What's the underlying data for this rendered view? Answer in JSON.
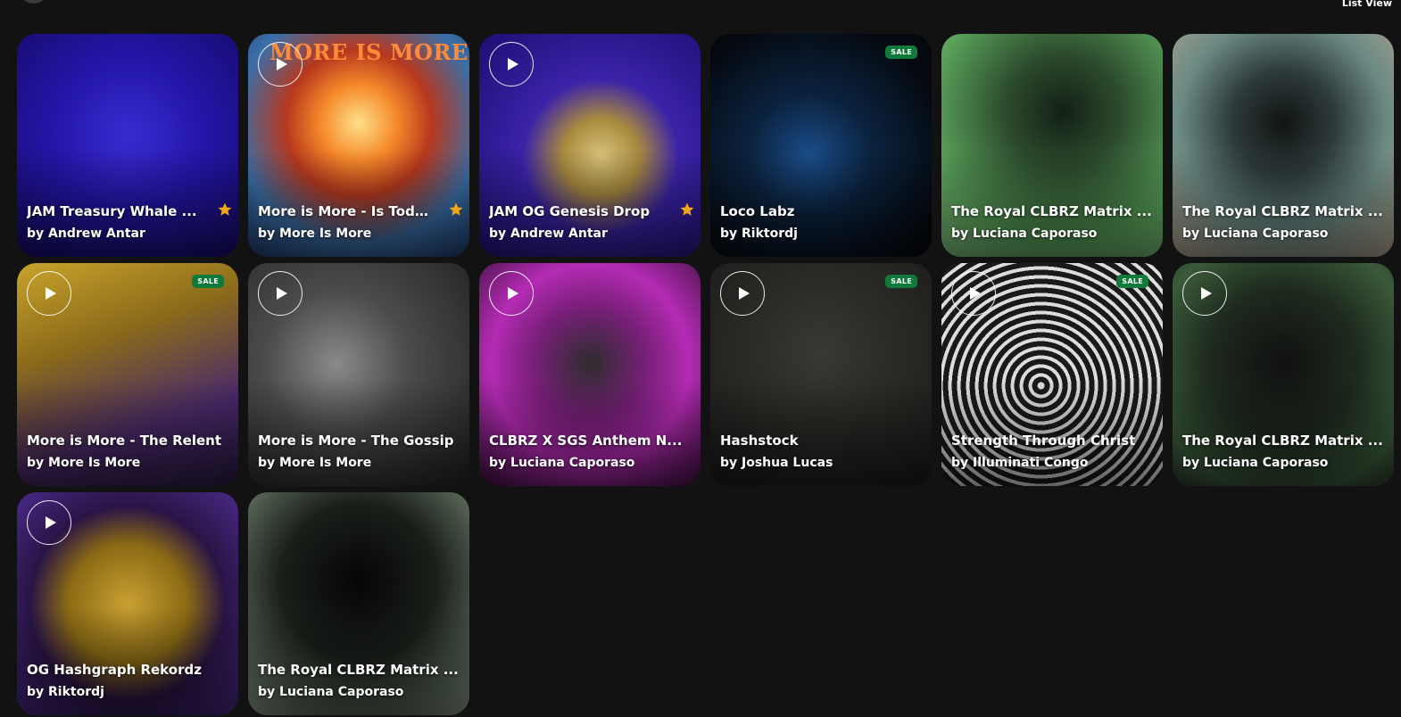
{
  "header": {
    "view_toggle_label": "List View"
  },
  "colors": {
    "background": "#121212",
    "sale_badge": "#0f7a3a",
    "star": "#f2a516"
  },
  "cards": [
    {
      "title": "JAM Treasury Whale ...",
      "artist": "by Andrew Antar",
      "has_play": false,
      "sale": false,
      "favorite": true,
      "art_text": "",
      "bg": "radial-gradient(circle at 50% 45%, #3a2bd1 0%, #2316a8 45%, #160b6a 100%)"
    },
    {
      "title": "More is More - Is Toda...",
      "artist": "by More Is More",
      "has_play": true,
      "sale": false,
      "favorite": true,
      "art_text": "MORE IS MORE",
      "bg": "radial-gradient(circle at 50% 40%, #ffe08a 0%, #f5892a 22%, #b8381e 42%, #3a6fa8 70%, #1d3c6e 100%)"
    },
    {
      "title": "JAM OG Genesis Drop",
      "artist": "by Andrew Antar",
      "has_play": true,
      "sale": false,
      "favorite": true,
      "art_text": "",
      "bg": "radial-gradient(circle at 55% 55%, #d8c27a 0%, #a88a3e 22%, #3b22a8 45%, #1c0e72 100%)"
    },
    {
      "title": "Loco Labz",
      "artist": "by Riktordj",
      "has_play": false,
      "sale": true,
      "favorite": false,
      "art_text": "",
      "bg": "radial-gradient(circle at 45% 55%, #1a4e8a 0%, #0b2340 35%, #05090f 80%)"
    },
    {
      "title": "The Royal CLBRZ Matrix ...",
      "artist": "by Luciana Caporaso",
      "has_play": false,
      "sale": false,
      "favorite": false,
      "art_text": "",
      "bg": "radial-gradient(circle at 55% 35%, #142016 0%, #2b4a2c 30%, #5aa35a 70%, #84c985 100%)"
    },
    {
      "title": "The Royal CLBRZ Matrix ...",
      "artist": "by Luciana Caporaso",
      "has_play": false,
      "sale": false,
      "favorite": false,
      "art_text": "",
      "bg": "radial-gradient(circle at 50% 40%, #101414 0%, #2e3b3a 30%, #6b8a84 60%, #b9a88f 100%)"
    },
    {
      "title": "More is More - The Relent",
      "artist": "by More Is More",
      "has_play": true,
      "sale": true,
      "favorite": false,
      "art_text": "",
      "bg": "linear-gradient(160deg, #c9a32b 0%, #8a6a1a 35%, #4a2a6a 70%, #2a1a44 100%)"
    },
    {
      "title": "More is More - The Gossip",
      "artist": "by More Is More",
      "has_play": true,
      "sale": false,
      "favorite": false,
      "art_text": "",
      "bg": "radial-gradient(circle at 40% 45%, #8a8a8a 0%, #4b4b4b 40%, #222222 100%)"
    },
    {
      "title": "CLBRZ X SGS Anthem N...",
      "artist": "by Luciana Caporaso",
      "has_play": true,
      "sale": false,
      "favorite": false,
      "art_text": "",
      "bg": "radial-gradient(circle at 50% 45%, #2d2d2d 0%, #7a1f7a 35%, #b42bb4 60%, #3a0f3a 100%)"
    },
    {
      "title": "Hashstock",
      "artist": "by Joshua Lucas",
      "has_play": true,
      "sale": true,
      "favorite": false,
      "art_text": "",
      "bg": "radial-gradient(circle at 50% 40%, #3a3834 0%, #2a2926 45%, #1a1918 100%)"
    },
    {
      "title": "Strength Through Christ",
      "artist": "by Illuminati Congo",
      "has_play": true,
      "sale": true,
      "favorite": false,
      "art_text": "",
      "bg": "repeating-radial-gradient(circle at 45% 55%, #dcdcdc 0px, #dcdcdc 4px, #1a1a1a 4px, #1a1a1a 10px)"
    },
    {
      "title": "The Royal CLBRZ Matrix ...",
      "artist": "by Luciana Caporaso",
      "has_play": true,
      "sale": false,
      "favorite": false,
      "art_text": "",
      "bg": "radial-gradient(circle at 50% 45%, #101010 0%, #1e2a1e 45%, #3a5a3a 80%, #2a3a2a 100%)"
    },
    {
      "title": "OG Hashgraph Rekordz",
      "artist": "by Riktordj",
      "has_play": true,
      "sale": false,
      "favorite": false,
      "art_text": "",
      "bg": "radial-gradient(circle at 50% 50%, #c9a032 0%, #8a6a14 38%, #2a1446 62%, #4a2a8a 100%)"
    },
    {
      "title": "The Royal CLBRZ Matrix ...",
      "artist": "by Luciana Caporaso",
      "has_play": false,
      "sale": false,
      "favorite": false,
      "art_text": "",
      "bg": "radial-gradient(circle at 50% 40%, #050505 0%, #1a1f1a 45%, #5a6a5a 80%, #8a9a8a 100%)"
    }
  ]
}
